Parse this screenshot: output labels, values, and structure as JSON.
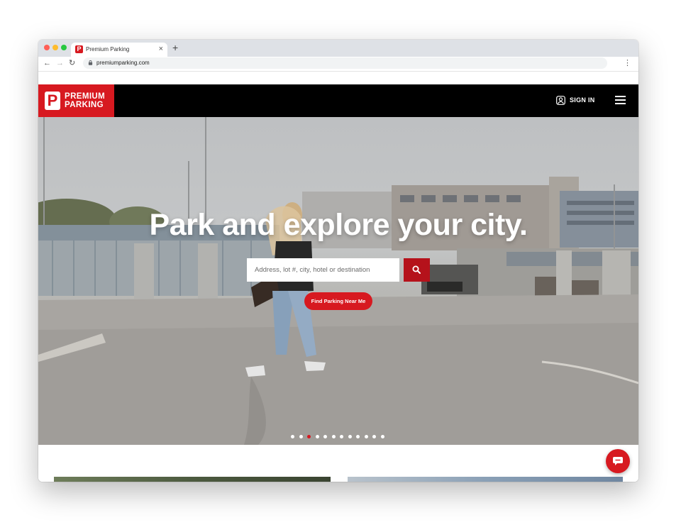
{
  "browser": {
    "tab_title": "Premium Parking",
    "tab_close": "×",
    "new_tab": "+",
    "url": "premiumparking.com",
    "favicon_letter": "P"
  },
  "header": {
    "logo_line1": "PREMIUM",
    "logo_line2": "PARKING",
    "logo_mark": "P",
    "sign_in": "SIGN IN",
    "brand_color": "#d71920"
  },
  "hero": {
    "headline": "Park and explore your city.",
    "search_placeholder": "Address, lot #, city, hotel or destination",
    "find_button": "Find Parking Near Me",
    "carousel_dot_count": 12,
    "carousel_active_index": 2
  },
  "icons": {
    "search": "search-icon",
    "user": "user-icon",
    "menu": "hamburger-menu-icon",
    "chat": "chat-icon",
    "lock": "lock-icon"
  }
}
